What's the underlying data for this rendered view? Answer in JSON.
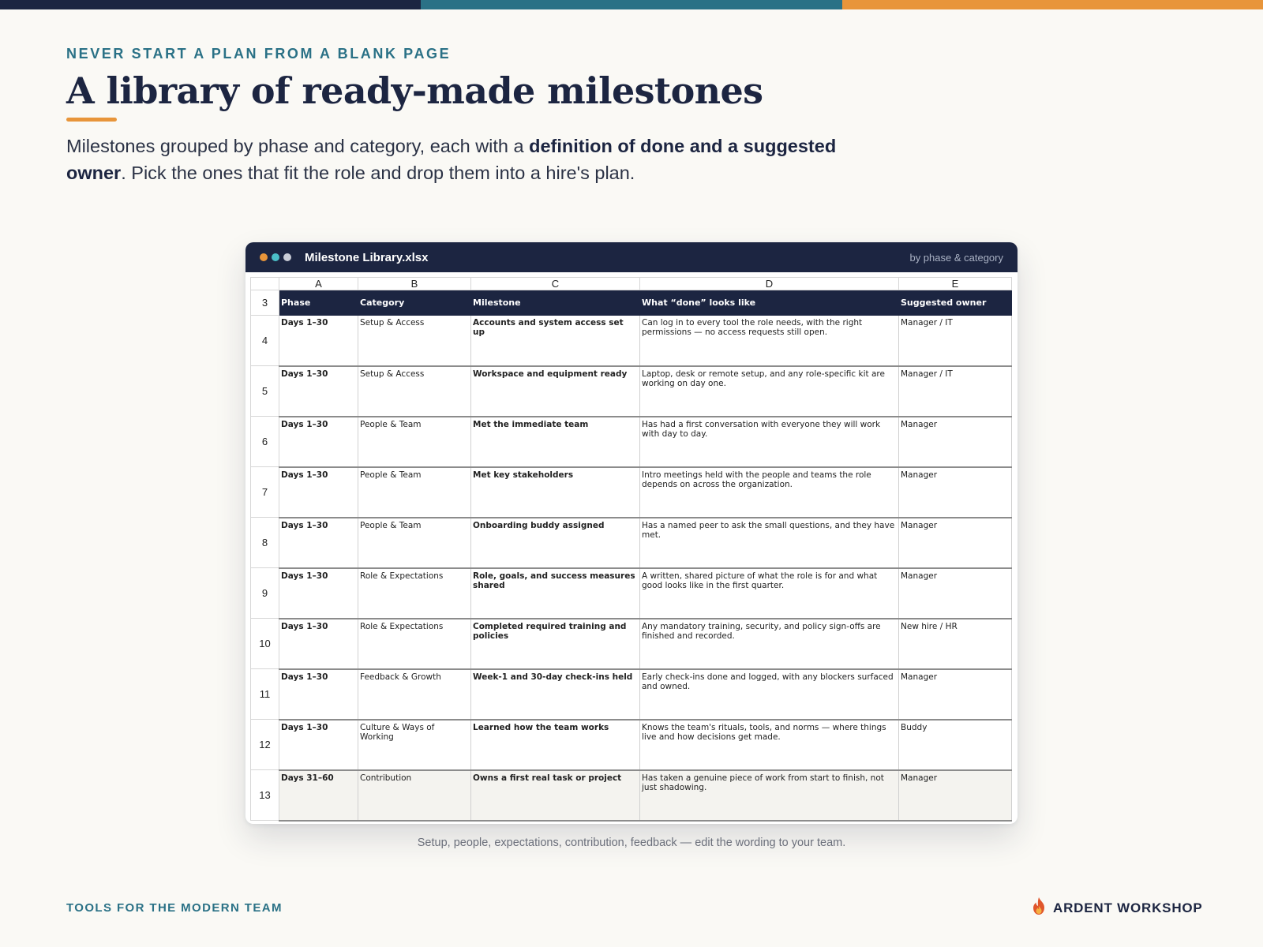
{
  "colors": {
    "navy": "#1c2541",
    "teal": "#2a7186",
    "orange": "#e8953a",
    "background": "#faf9f5"
  },
  "eyebrow": "NEVER START A PLAN FROM A BLANK PAGE",
  "title": "A library of ready-made milestones",
  "subtitle": {
    "part1": "Milestones grouped by phase and category, each with a ",
    "bold": "definition of done and a suggested owner",
    "part2": ". Pick the ones that fit the role and drop them into a hire's plan."
  },
  "window": {
    "filename": "Milestone Library.xlsx",
    "right_label": "by phase & category",
    "dot_colors": [
      "#e8953a",
      "#4bbfc8",
      "#c9ccd6"
    ]
  },
  "sheet": {
    "column_letters": [
      "A",
      "B",
      "C",
      "D",
      "E"
    ],
    "header_row_number": "3",
    "headers": [
      "Phase",
      "Category",
      "Milestone",
      "What “done” looks like",
      "Suggested owner"
    ],
    "rows": [
      {
        "n": "4",
        "phase": "Days 1–30",
        "category": "Setup & Access",
        "milestone": "Accounts and system access set up",
        "done": "Can log in to every tool the role needs, with the right permissions — no access requests still open.",
        "owner": "Manager / IT"
      },
      {
        "n": "5",
        "phase": "Days 1–30",
        "category": "Setup & Access",
        "milestone": "Workspace and equipment ready",
        "done": "Laptop, desk or remote setup, and any role-specific kit are working on day one.",
        "owner": "Manager / IT"
      },
      {
        "n": "6",
        "phase": "Days 1–30",
        "category": "People & Team",
        "milestone": "Met the immediate team",
        "done": "Has had a first conversation with everyone they will work with day to day.",
        "owner": "Manager"
      },
      {
        "n": "7",
        "phase": "Days 1–30",
        "category": "People & Team",
        "milestone": "Met key stakeholders",
        "done": "Intro meetings held with the people and teams the role depends on across the organization.",
        "owner": "Manager"
      },
      {
        "n": "8",
        "phase": "Days 1–30",
        "category": "People & Team",
        "milestone": "Onboarding buddy assigned",
        "done": "Has a named peer to ask the small questions, and they have met.",
        "owner": "Manager"
      },
      {
        "n": "9",
        "phase": "Days 1–30",
        "category": "Role & Expectations",
        "milestone": "Role, goals, and success measures shared",
        "done": "A written, shared picture of what the role is for and what good looks like in the first quarter.",
        "owner": "Manager"
      },
      {
        "n": "10",
        "phase": "Days 1–30",
        "category": "Role & Expectations",
        "milestone": "Completed required training and policies",
        "done": "Any mandatory training, security, and policy sign-offs are finished and recorded.",
        "owner": "New hire / HR"
      },
      {
        "n": "11",
        "phase": "Days 1–30",
        "category": "Feedback & Growth",
        "milestone": "Week-1 and 30-day check-ins held",
        "done": "Early check-ins done and logged, with any blockers surfaced and owned.",
        "owner": "Manager"
      },
      {
        "n": "12",
        "phase": "Days 1–30",
        "category": "Culture & Ways of Working",
        "milestone": "Learned how the team works",
        "done": "Knows the team's rituals, tools, and norms — where things live and how decisions get made.",
        "owner": "Buddy"
      },
      {
        "n": "13",
        "phase": "Days 31–60",
        "category": "Contribution",
        "milestone": "Owns a first real task or project",
        "done": "Has taken a genuine piece of work from start to finish, not just shadowing.",
        "owner": "Manager"
      }
    ]
  },
  "caption": "Setup, people, expectations, contribution, feedback — edit the wording to your team.",
  "footer": {
    "left": "TOOLS FOR THE MODERN TEAM",
    "brand": "ARDENT WORKSHOP",
    "brand_icon": "flame-icon"
  }
}
